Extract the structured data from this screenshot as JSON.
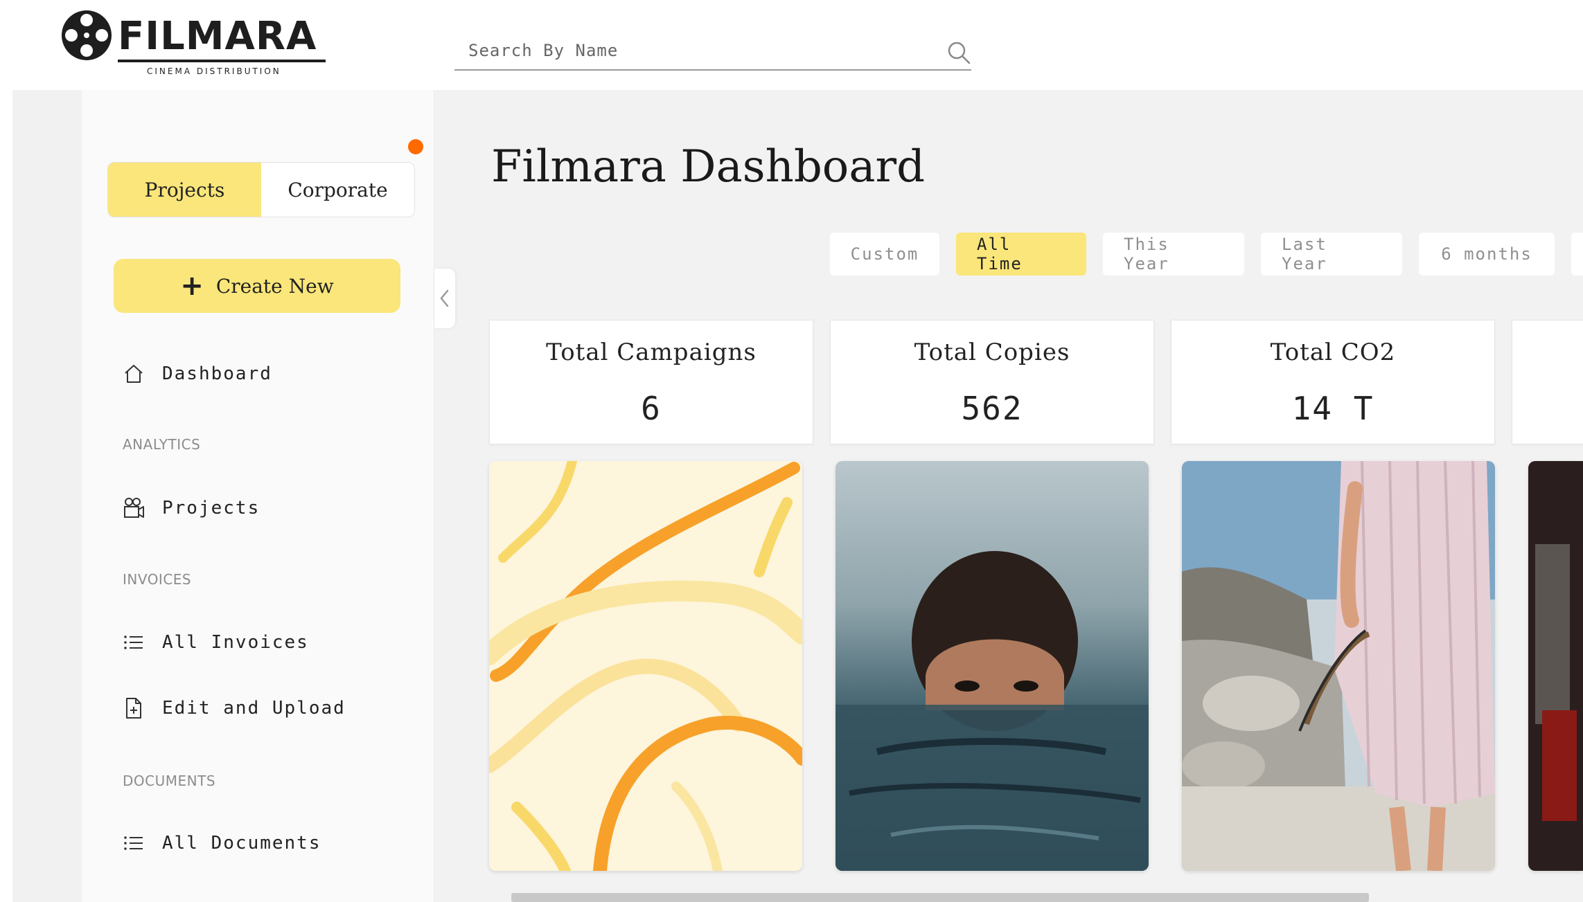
{
  "brand": {
    "name": "FILMARA",
    "tagline": "CINEMA DISTRIBUTION"
  },
  "search": {
    "placeholder": "Search By Name",
    "icon": "search-icon"
  },
  "sidebar": {
    "toggle": {
      "projects": "Projects",
      "corporate": "Corporate",
      "active": "projects"
    },
    "create_label": "Create New",
    "items": {
      "dashboard": {
        "label": "Dashboard",
        "icon": "home-icon"
      },
      "analytics_label": "ANALYTICS",
      "projects": {
        "label": "Projects",
        "icon": "camera-icon"
      },
      "invoices_label": "INVOICES",
      "all_invoices": {
        "label": "All Invoices",
        "icon": "list-icon"
      },
      "edit_upload": {
        "label": "Edit and Upload",
        "icon": "file-plus-icon"
      },
      "documents_label": "DOCUMENTS",
      "all_documents": {
        "label": "All Documents",
        "icon": "list-icon"
      }
    }
  },
  "main": {
    "title": "Filmara Dashboard",
    "filters": [
      "Custom",
      "All Time",
      "This Year",
      "Last Year",
      "6 months"
    ],
    "active_filter": "All Time",
    "stats": [
      {
        "title": "Total Campaigns",
        "value": "6"
      },
      {
        "title": "Total Copies",
        "value": "562"
      },
      {
        "title": "Total CO2",
        "value": "14 T"
      }
    ]
  },
  "colors": {
    "accent_yellow": "#fae67a",
    "notification": "#ff6a00",
    "background": "#f2f2f2",
    "sidebar": "#fafafa"
  }
}
